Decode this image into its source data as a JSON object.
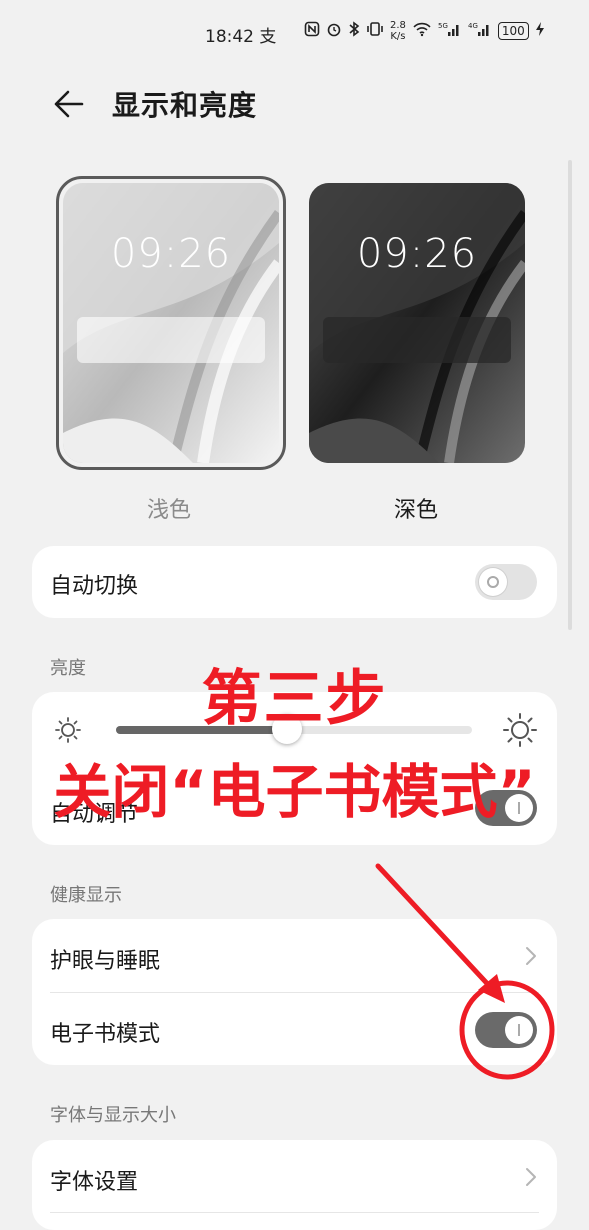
{
  "status_bar": {
    "time": "18:42",
    "time_extra": "支",
    "net_speed_value": "2.8",
    "net_speed_unit": "K/s",
    "battery": "100"
  },
  "header": {
    "title": "显示和亮度"
  },
  "themes": {
    "light": {
      "label": "浅色",
      "preview_time": "09:26"
    },
    "dark": {
      "label": "深色",
      "preview_time": "09:26"
    }
  },
  "auto_switch": {
    "label": "自动切换",
    "enabled": false
  },
  "brightness": {
    "section_label": "亮度",
    "level": 0.48,
    "auto_label": "自动调节",
    "auto_enabled": true
  },
  "health_display": {
    "section_label": "健康显示",
    "eye_comfort_label": "护眼与睡眠",
    "ebook_mode_label": "电子书模式",
    "ebook_mode_enabled": true
  },
  "font_display": {
    "section_label": "字体与显示大小",
    "font_settings_label": "字体设置"
  },
  "annotation": {
    "step": "第三步",
    "instruction": "关闭“电子书模式”",
    "color": "#ee1c25"
  }
}
